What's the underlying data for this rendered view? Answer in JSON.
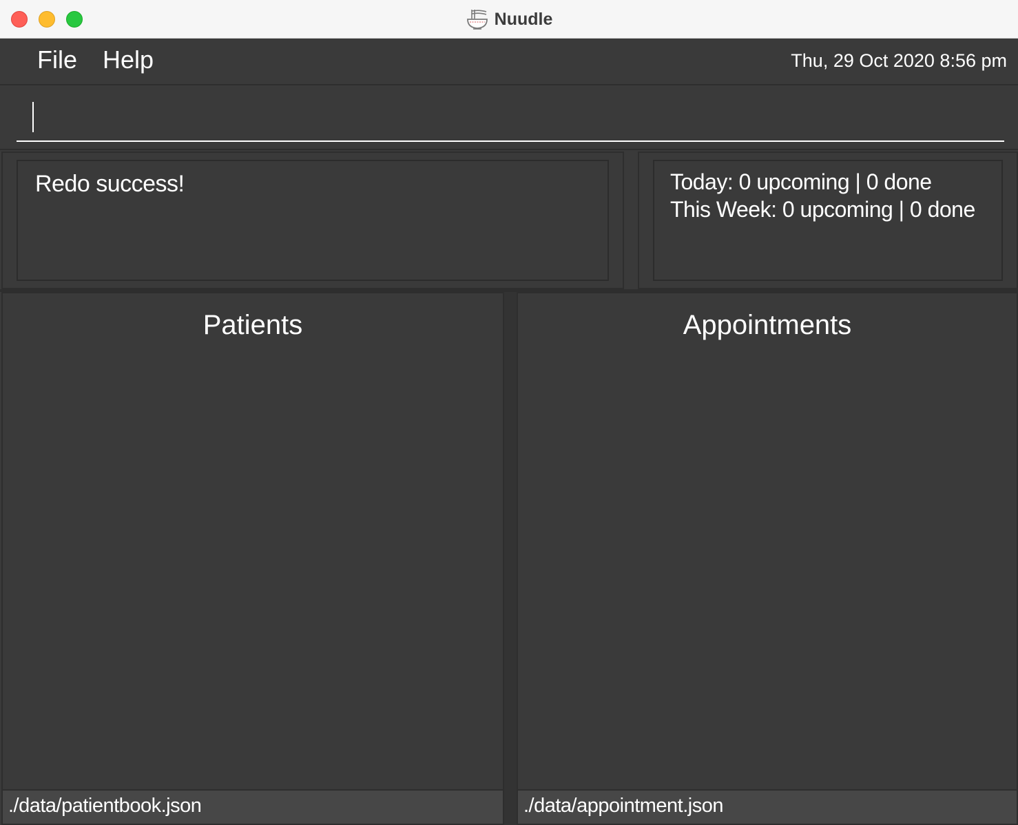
{
  "window": {
    "title": "Nuudle",
    "app_icon": "noodle-bowl-icon"
  },
  "menubar": {
    "file_label": "File",
    "help_label": "Help",
    "datetime": "Thu, 29 Oct 2020 8:56 pm"
  },
  "command_box": {
    "value": "",
    "placeholder": ""
  },
  "result_display": {
    "message": "Redo success!"
  },
  "stats": {
    "today": "Today: 0 upcoming | 0 done",
    "this_week": "This Week: 0 upcoming | 0 done"
  },
  "patients_panel": {
    "title": "Patients",
    "items": [],
    "file_path": "./data/patientbook.json"
  },
  "appointments_panel": {
    "title": "Appointments",
    "items": [],
    "file_path": "./data/appointment.json"
  },
  "colors": {
    "background": "#3a3a3a",
    "footer": "#474747",
    "text": "#ffffff",
    "traffic_close": "#fe5f57",
    "traffic_minimize": "#febc2e",
    "traffic_maximize": "#28c840"
  }
}
